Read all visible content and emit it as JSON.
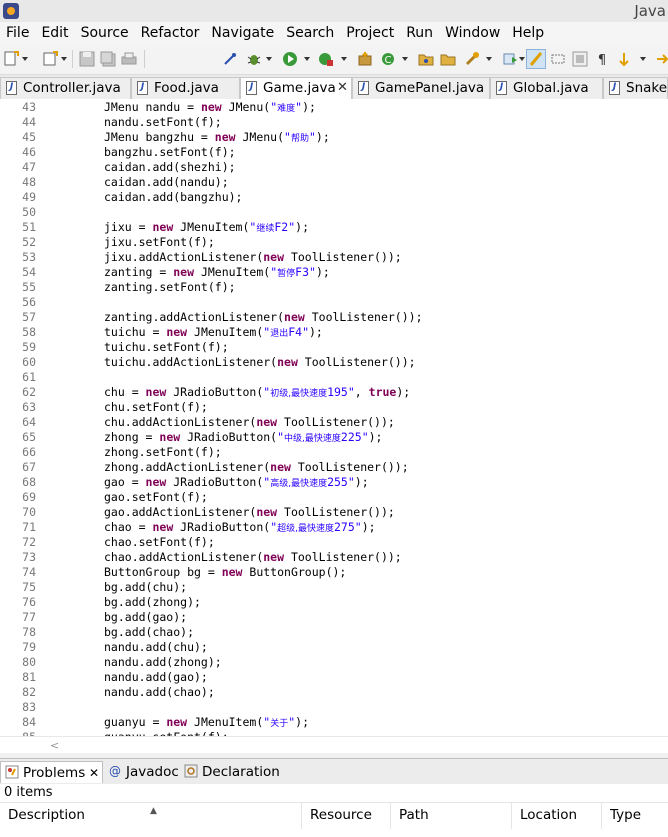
{
  "window": {
    "title": "Java"
  },
  "menu": [
    "File",
    "Edit",
    "Source",
    "Refactor",
    "Navigate",
    "Search",
    "Project",
    "Run",
    "Window",
    "Help"
  ],
  "toolbar_icons": [
    "new-icon",
    "new-dropdown-icon",
    "new-class-icon",
    "save-icon",
    "save-all-icon",
    "print-icon",
    "pin-icon",
    "debug-icon",
    "run-icon",
    "external-tools-icon",
    "new-package-icon",
    "new-java-class-icon",
    "open-type-icon",
    "open-task-icon",
    "search-icon",
    "next-annotation-icon",
    "toggle-mark-occurrences-icon",
    "toggle-block-selection-icon",
    "show-whitespace-icon",
    "last-edit-icon",
    "navigate-back-icon",
    "navigate-forward-icon"
  ],
  "tabs": [
    {
      "label": "Controller.java",
      "active": false,
      "closable": false
    },
    {
      "label": "Food.java",
      "active": false,
      "closable": false
    },
    {
      "label": "Game.java",
      "active": true,
      "closable": true
    },
    {
      "label": "GamePanel.java",
      "active": false,
      "closable": false
    },
    {
      "label": "Global.java",
      "active": false,
      "closable": false
    },
    {
      "label": "Snake.j",
      "active": false,
      "closable": false
    }
  ],
  "editor": {
    "first_line": 43,
    "lines": [
      [
        [
          "t",
          "JMenu nandu = "
        ],
        [
          "k",
          "new"
        ],
        [
          "t",
          " JMenu("
        ],
        [
          "s",
          "\""
        ],
        [
          "c",
          "难度"
        ],
        [
          "s",
          "\""
        ],
        [
          "t",
          ");"
        ]
      ],
      [
        [
          "t",
          "nandu.setFont(f);"
        ]
      ],
      [
        [
          "t",
          "JMenu bangzhu = "
        ],
        [
          "k",
          "new"
        ],
        [
          "t",
          " JMenu("
        ],
        [
          "s",
          "\""
        ],
        [
          "c",
          "帮助"
        ],
        [
          "s",
          "\""
        ],
        [
          "t",
          ");"
        ]
      ],
      [
        [
          "t",
          "bangzhu.setFont(f);"
        ]
      ],
      [
        [
          "t",
          "caidan.add(shezhi);"
        ]
      ],
      [
        [
          "t",
          "caidan.add(nandu);"
        ]
      ],
      [
        [
          "t",
          "caidan.add(bangzhu);"
        ]
      ],
      [],
      [
        [
          "t",
          "jixu = "
        ],
        [
          "k",
          "new"
        ],
        [
          "t",
          " JMenuItem("
        ],
        [
          "s",
          "\""
        ],
        [
          "c",
          "继续"
        ],
        [
          "s",
          "F2\""
        ],
        [
          "t",
          ");"
        ]
      ],
      [
        [
          "t",
          "jixu.setFont(f);"
        ]
      ],
      [
        [
          "t",
          "jixu.addActionListener("
        ],
        [
          "k",
          "new"
        ],
        [
          "t",
          " ToolListener());"
        ]
      ],
      [
        [
          "t",
          "zanting = "
        ],
        [
          "k",
          "new"
        ],
        [
          "t",
          " JMenuItem("
        ],
        [
          "s",
          "\""
        ],
        [
          "c",
          "暂停"
        ],
        [
          "s",
          "F3\""
        ],
        [
          "t",
          ");"
        ]
      ],
      [
        [
          "t",
          "zanting.setFont(f);"
        ]
      ],
      [],
      [
        [
          "t",
          "zanting.addActionListener("
        ],
        [
          "k",
          "new"
        ],
        [
          "t",
          " ToolListener());"
        ]
      ],
      [
        [
          "t",
          "tuichu = "
        ],
        [
          "k",
          "new"
        ],
        [
          "t",
          " JMenuItem("
        ],
        [
          "s",
          "\""
        ],
        [
          "c",
          "退出"
        ],
        [
          "s",
          "F4\""
        ],
        [
          "t",
          ");"
        ]
      ],
      [
        [
          "t",
          "tuichu.setFont(f);"
        ]
      ],
      [
        [
          "t",
          "tuichu.addActionListener("
        ],
        [
          "k",
          "new"
        ],
        [
          "t",
          " ToolListener());"
        ]
      ],
      [],
      [
        [
          "t",
          "chu = "
        ],
        [
          "k",
          "new"
        ],
        [
          "t",
          " JRadioButton("
        ],
        [
          "s",
          "\""
        ],
        [
          "c",
          "初级,最快速度"
        ],
        [
          "s",
          "195\""
        ],
        [
          "t",
          ", "
        ],
        [
          "k",
          "true"
        ],
        [
          "t",
          ");"
        ]
      ],
      [
        [
          "t",
          "chu.setFont(f);"
        ]
      ],
      [
        [
          "t",
          "chu.addActionListener("
        ],
        [
          "k",
          "new"
        ],
        [
          "t",
          " ToolListener());"
        ]
      ],
      [
        [
          "t",
          "zhong = "
        ],
        [
          "k",
          "new"
        ],
        [
          "t",
          " JRadioButton("
        ],
        [
          "s",
          "\""
        ],
        [
          "c",
          "中级,最快速度"
        ],
        [
          "s",
          "225\""
        ],
        [
          "t",
          ");"
        ]
      ],
      [
        [
          "t",
          "zhong.setFont(f);"
        ]
      ],
      [
        [
          "t",
          "zhong.addActionListener("
        ],
        [
          "k",
          "new"
        ],
        [
          "t",
          " ToolListener());"
        ]
      ],
      [
        [
          "t",
          "gao = "
        ],
        [
          "k",
          "new"
        ],
        [
          "t",
          " JRadioButton("
        ],
        [
          "s",
          "\""
        ],
        [
          "c",
          "高级,最快速度"
        ],
        [
          "s",
          "255\""
        ],
        [
          "t",
          ");"
        ]
      ],
      [
        [
          "t",
          "gao.setFont(f);"
        ]
      ],
      [
        [
          "t",
          "gao.addActionListener("
        ],
        [
          "k",
          "new"
        ],
        [
          "t",
          " ToolListener());"
        ]
      ],
      [
        [
          "t",
          "chao = "
        ],
        [
          "k",
          "new"
        ],
        [
          "t",
          " JRadioButton("
        ],
        [
          "s",
          "\""
        ],
        [
          "c",
          "超级,最快速度"
        ],
        [
          "s",
          "275\""
        ],
        [
          "t",
          ");"
        ]
      ],
      [
        [
          "t",
          "chao.setFont(f);"
        ]
      ],
      [
        [
          "t",
          "chao.addActionListener("
        ],
        [
          "k",
          "new"
        ],
        [
          "t",
          " ToolListener());"
        ]
      ],
      [
        [
          "t",
          "ButtonGroup bg = "
        ],
        [
          "k",
          "new"
        ],
        [
          "t",
          " ButtonGroup();"
        ]
      ],
      [
        [
          "t",
          "bg.add(chu);"
        ]
      ],
      [
        [
          "t",
          "bg.add(zhong);"
        ]
      ],
      [
        [
          "t",
          "bg.add(gao);"
        ]
      ],
      [
        [
          "t",
          "bg.add(chao);"
        ]
      ],
      [
        [
          "t",
          "nandu.add(chu);"
        ]
      ],
      [
        [
          "t",
          "nandu.add(zhong);"
        ]
      ],
      [
        [
          "t",
          "nandu.add(gao);"
        ]
      ],
      [
        [
          "t",
          "nandu.add(chao);"
        ]
      ],
      [],
      [
        [
          "t",
          "guanyu = "
        ],
        [
          "k",
          "new"
        ],
        [
          "t",
          " JMenuItem("
        ],
        [
          "s",
          "\""
        ],
        [
          "c",
          "关于"
        ],
        [
          "s",
          "\""
        ],
        [
          "t",
          ");"
        ]
      ],
      [
        [
          "t",
          "guanyu.setFont(f);"
        ]
      ]
    ]
  },
  "bottom_tabs": [
    {
      "label": "Problems",
      "icon": "problems-icon",
      "active": true,
      "closable": true
    },
    {
      "label": "Javadoc",
      "icon": "javadoc-icon",
      "active": false,
      "closable": false
    },
    {
      "label": "Declaration",
      "icon": "declaration-icon",
      "active": false,
      "closable": false
    }
  ],
  "problems": {
    "status": "0 items",
    "columns": [
      "Description",
      "Resource",
      "Path",
      "Location",
      "Type"
    ]
  },
  "colors": {
    "keyword": "#7f0055",
    "string": "#2a00ff",
    "line_number": "#787878"
  }
}
